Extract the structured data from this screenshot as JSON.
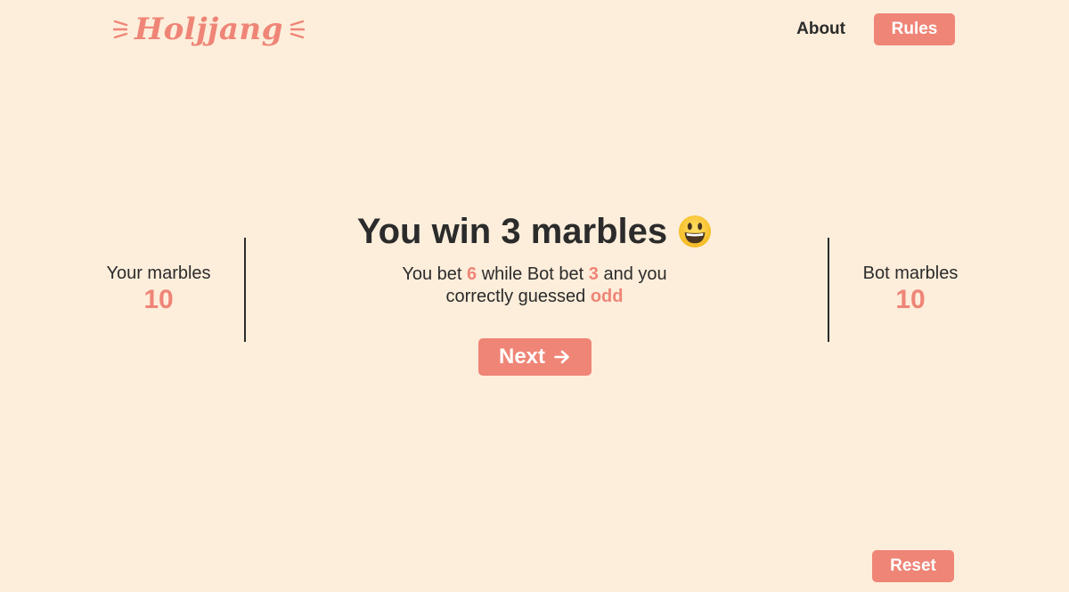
{
  "brand": {
    "name": "Holjjang",
    "color": "#ef8577",
    "background": "#fdeedb"
  },
  "nav": {
    "about_label": "About",
    "rules_label": "Rules"
  },
  "player": {
    "label": "Your marbles",
    "marbles": "10"
  },
  "bot": {
    "label": "Bot marbles",
    "marbles": "10"
  },
  "result": {
    "title": "You win 3 marbles",
    "title_icon": "grinning-face-icon",
    "detail": {
      "prefix": "You bet ",
      "player_bet": "6",
      "middle": " while Bot bet ",
      "bot_bet": "3",
      "suffix": " and you correctly guessed ",
      "guess": "odd"
    }
  },
  "actions": {
    "next_label": "Next",
    "next_icon": "arrow-right-icon",
    "reset_label": "Reset"
  }
}
